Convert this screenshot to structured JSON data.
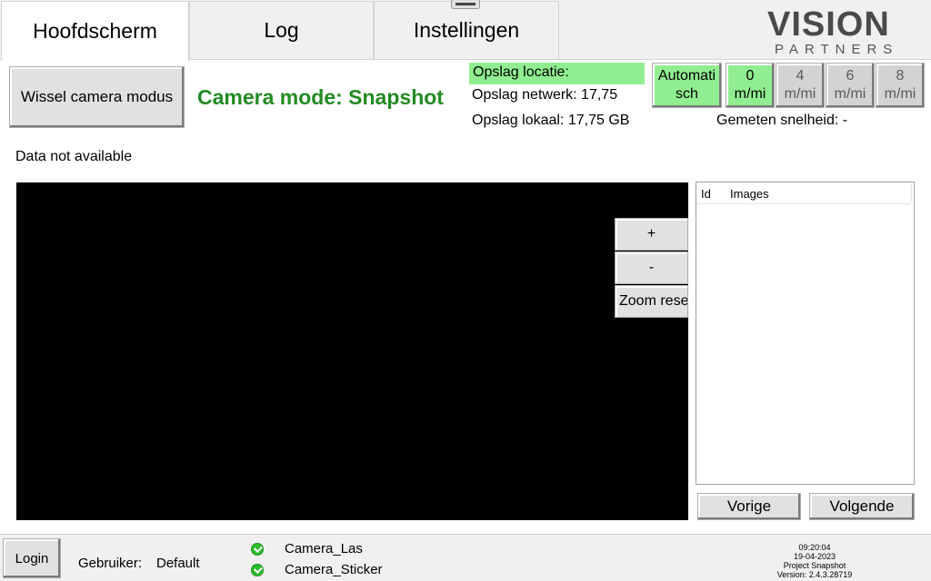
{
  "tabs": [
    {
      "label": "Hoofdscherm",
      "active": true
    },
    {
      "label": "Log",
      "active": false
    },
    {
      "label": "Instellingen",
      "active": false
    }
  ],
  "logo": {
    "main": "VISION",
    "sub": "PARTNERS"
  },
  "controls": {
    "switch_camera_label": "Wissel camera modus",
    "camera_mode": "Camera mode: Snapshot"
  },
  "storage": {
    "location": "Opslag locatie:",
    "network": "Opslag netwerk: 17,75",
    "local": "Opslag lokaal: 17,75 GB"
  },
  "speed": {
    "auto_line1": "Automati",
    "auto_line2": "sch",
    "options": [
      {
        "value": "0",
        "unit": "m/mi"
      },
      {
        "value": "4",
        "unit": "m/mi"
      },
      {
        "value": "6",
        "unit": "m/mi"
      },
      {
        "value": "8",
        "unit": "m/mi"
      }
    ],
    "measured": "Gemeten snelheid: -"
  },
  "data_status": "Data not available",
  "zoom": {
    "in": "+",
    "out": "-",
    "reset": "Zoom reset"
  },
  "image_list": {
    "col_id": "Id",
    "col_images": "Images"
  },
  "nav": {
    "prev": "Vorige",
    "next": "Volgende"
  },
  "footer": {
    "login": "Login",
    "user_label": "Gebruiker:",
    "user_name": "Default",
    "cameras": [
      "Camera_Las",
      "Camera_Sticker"
    ],
    "time": "09:20:04",
    "date": "19-04-2023",
    "project": "Project Snapshot",
    "version": "Version: 2.4.3.28719"
  },
  "colors": {
    "active_green": "#90ee90",
    "mode_text": "#228b22",
    "status_ok": "#2ebd2e"
  }
}
